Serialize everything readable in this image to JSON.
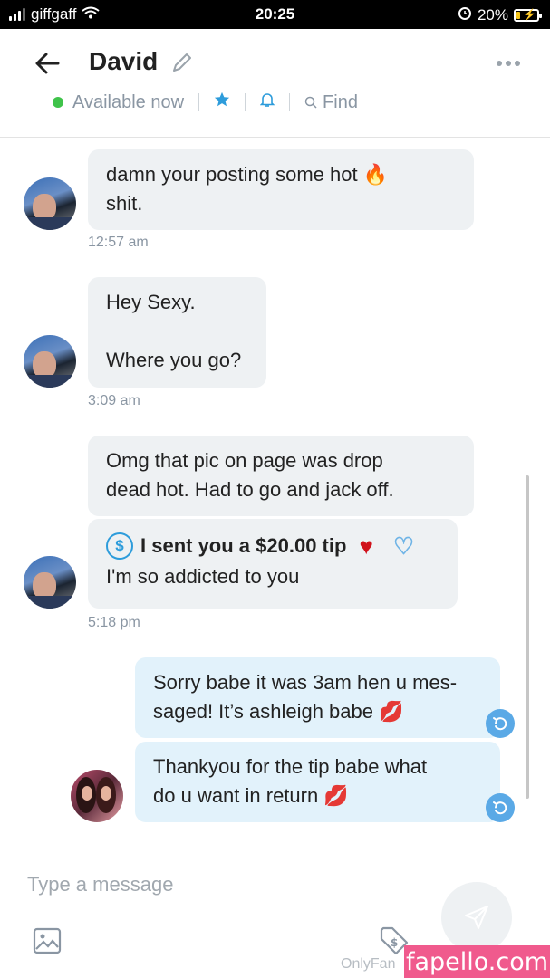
{
  "status_bar": {
    "carrier": "giffgaff",
    "time": "20:25",
    "battery": "20%",
    "battery_level": 0.2
  },
  "header": {
    "name": "David",
    "status": "Available now",
    "find_label": "Find",
    "icons": {
      "back": "arrow-left-icon",
      "edit": "pencil-icon",
      "more": "more-dots-icon",
      "star": "star-icon",
      "bell": "bell-icon",
      "search": "search-icon"
    }
  },
  "messages": [
    {
      "from": "david",
      "text_lines": [
        "damn your posting some hot 🔥",
        "shit."
      ],
      "time": "12:57 am"
    },
    {
      "from": "david",
      "text_lines": [
        "Hey Sexy.",
        "",
        "Where you go?"
      ],
      "time": "3:09 am"
    },
    {
      "from": "david",
      "text_lines": [
        "Omg that pic on page was drop",
        "dead hot. Had to go and jack off."
      ]
    },
    {
      "from": "david",
      "tip_text": "I sent you a $20.00 tip",
      "text": "I'm so addicted to you",
      "time": "5:18 pm"
    },
    {
      "from": "me",
      "text_lines": [
        "Sorry babe it was 3am hen u mes-",
        "saged! It’s ashleigh babe 💋"
      ]
    },
    {
      "from": "me",
      "text_lines": [
        "Thankyou for the tip babe what",
        "do u want in return 💋"
      ]
    }
  ],
  "composer": {
    "placeholder": "Type a message",
    "brand": "OnlyFan",
    "watermark": "fapello.com"
  },
  "colors": {
    "accent": "#2d9cdb",
    "online": "#3fc34a",
    "out_bubble": "#e2f2fb",
    "in_bubble": "#eef1f3",
    "watermark": "#f05a8d"
  }
}
